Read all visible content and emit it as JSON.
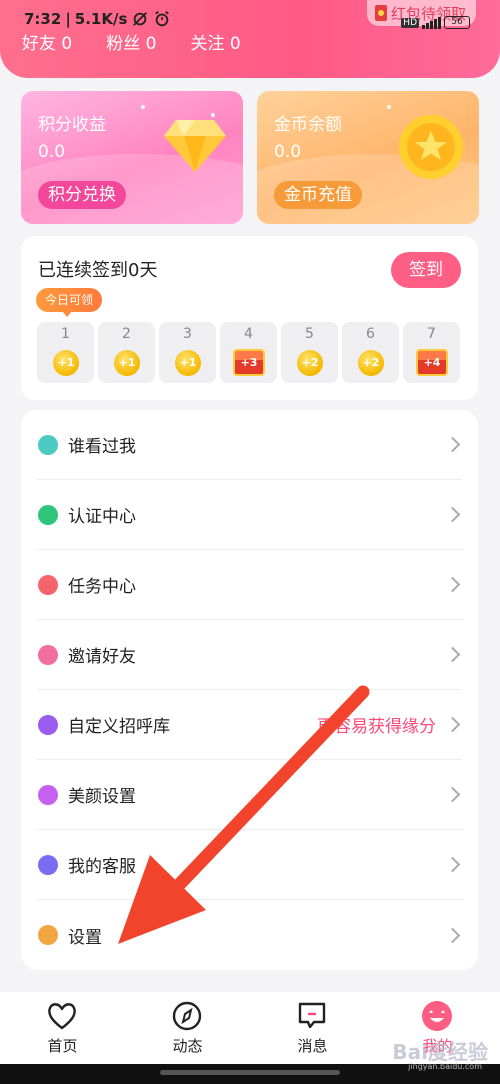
{
  "status": {
    "time": "7:32",
    "speed": "5.1K/s",
    "battery": "56",
    "hd": "HD"
  },
  "header": {
    "friends_label": "好友",
    "friends_count": "0",
    "fans_label": "粉丝",
    "fans_count": "0",
    "follow_label": "关注",
    "follow_count": "0",
    "red_packet": "红包待领取"
  },
  "points_card": {
    "title": "积分收益",
    "value": "0.0",
    "button": "积分兑换"
  },
  "coins_card": {
    "title": "金币余额",
    "value": "0.0",
    "button": "金币充值"
  },
  "signin": {
    "title": "已连续签到0天",
    "button": "签到",
    "tip": "今日可领",
    "days": [
      {
        "day": "1",
        "reward": "+1",
        "kind": "coin"
      },
      {
        "day": "2",
        "reward": "+1",
        "kind": "coin"
      },
      {
        "day": "3",
        "reward": "+1",
        "kind": "coin"
      },
      {
        "day": "4",
        "reward": "+3",
        "kind": "chest"
      },
      {
        "day": "5",
        "reward": "+2",
        "kind": "coin"
      },
      {
        "day": "6",
        "reward": "+2",
        "kind": "coin"
      },
      {
        "day": "7",
        "reward": "+4",
        "kind": "chest"
      }
    ]
  },
  "menu": [
    {
      "label": "谁看过我",
      "icon": "eye-icon",
      "color": "#4cc9c0"
    },
    {
      "label": "认证中心",
      "icon": "shield-check-icon",
      "color": "#2fc57a"
    },
    {
      "label": "任务中心",
      "icon": "diamond-task-icon",
      "color": "#f4656b"
    },
    {
      "label": "邀请好友",
      "icon": "envelope-icon",
      "color": "#f26ea0"
    },
    {
      "label": "自定义招呼库",
      "icon": "chat-heart-icon",
      "color": "#9b5cf0",
      "extra": "更容易获得缘分"
    },
    {
      "label": "美颜设置",
      "icon": "smile-icon",
      "color": "#c560f0"
    },
    {
      "label": "我的客服",
      "icon": "headset-icon",
      "color": "#7a6cf0"
    },
    {
      "label": "设置",
      "icon": "gear-hex-icon",
      "color": "#f2a640"
    }
  ],
  "tabs": [
    {
      "label": "首页",
      "icon": "heart-icon"
    },
    {
      "label": "动态",
      "icon": "compass-icon"
    },
    {
      "label": "消息",
      "icon": "message-icon"
    },
    {
      "label": "我的",
      "icon": "profile-emoji-icon"
    }
  ],
  "watermark": {
    "main": "Bai度经验",
    "sub": "jingyan.baidu.com"
  },
  "colors": {
    "accent": "#ff5f84",
    "arrow": "#f2442c"
  }
}
